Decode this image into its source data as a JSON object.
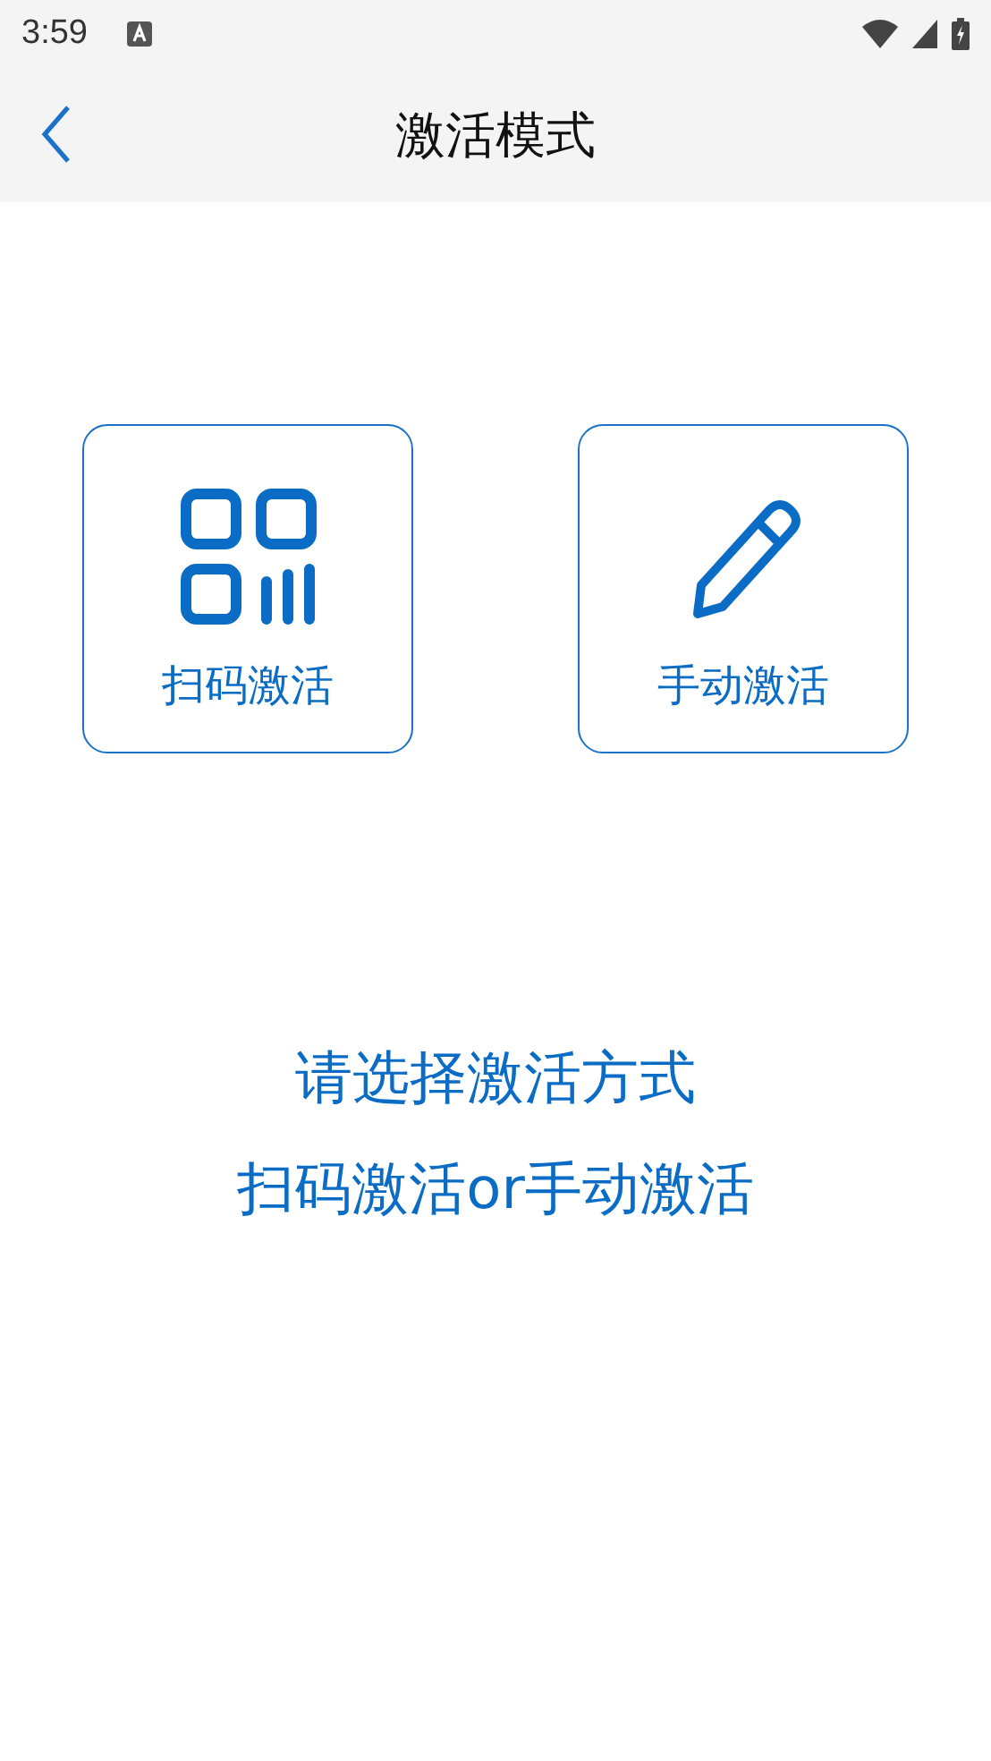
{
  "status_bar": {
    "time": "3:59"
  },
  "header": {
    "title": "激活模式"
  },
  "options": [
    {
      "kind": "scan",
      "label": "扫码激活"
    },
    {
      "kind": "manual",
      "label": "手动激活"
    }
  ],
  "prompt": [
    "请选择激活方式",
    "扫码激活or手动激活"
  ]
}
